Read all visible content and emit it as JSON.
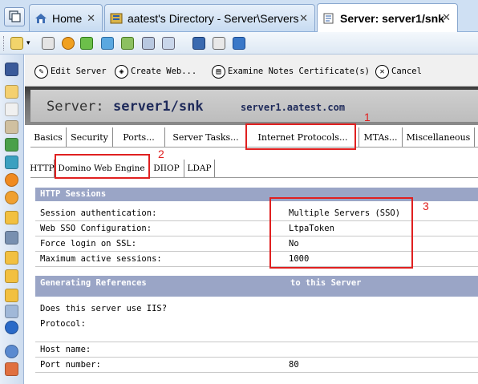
{
  "browser_tabs": [
    {
      "label": "Home",
      "close": "✕"
    },
    {
      "label": "aatest's Directory - Server\\Servers",
      "close": "✕"
    },
    {
      "label": "Server: server1/snk",
      "close": "✕"
    }
  ],
  "actions": [
    {
      "label": "Edit Server",
      "icon": "✎"
    },
    {
      "label": "Create Web...",
      "icon": "◈"
    },
    {
      "label": "Examine Notes Certificate(s)",
      "icon": "▤"
    },
    {
      "label": "Cancel",
      "icon": "✕"
    }
  ],
  "header": {
    "prefix": "Server:",
    "server_name": "server1/snk",
    "hostname": "server1.aatest.com"
  },
  "main_tabs": [
    "Basics",
    "Security",
    "Ports...",
    "Server Tasks...",
    "Internet Protocols...",
    "MTAs...",
    "Miscellaneous"
  ],
  "sub_tabs": [
    "HTTP",
    "Domino Web Engine",
    "DIIOP",
    "LDAP"
  ],
  "http_sessions": {
    "title": "HTTP Sessions",
    "rows": [
      {
        "label": "Session authentication:",
        "value": "Multiple Servers (SSO)"
      },
      {
        "label": "Web SSO Configuration:",
        "value": "LtpaToken"
      },
      {
        "label": "Force login on SSL:",
        "value": "No"
      },
      {
        "label": "Maximum active sessions:",
        "value": "1000"
      }
    ]
  },
  "generating_refs": {
    "title_left": "Generating References",
    "title_right": "to this Server",
    "rows": [
      {
        "label": "Does this server use IIS?",
        "value": ""
      },
      {
        "label": "Protocol:",
        "value": ""
      },
      {
        "label": "Host name:",
        "value": ""
      },
      {
        "label": "Port number:",
        "value": "80"
      }
    ]
  },
  "annotations": [
    "1",
    "2",
    "3"
  ],
  "colors": {
    "annotation": "#e02020",
    "section_bar": "#9aa5c6",
    "tab_strip": "#cfe0f3"
  }
}
